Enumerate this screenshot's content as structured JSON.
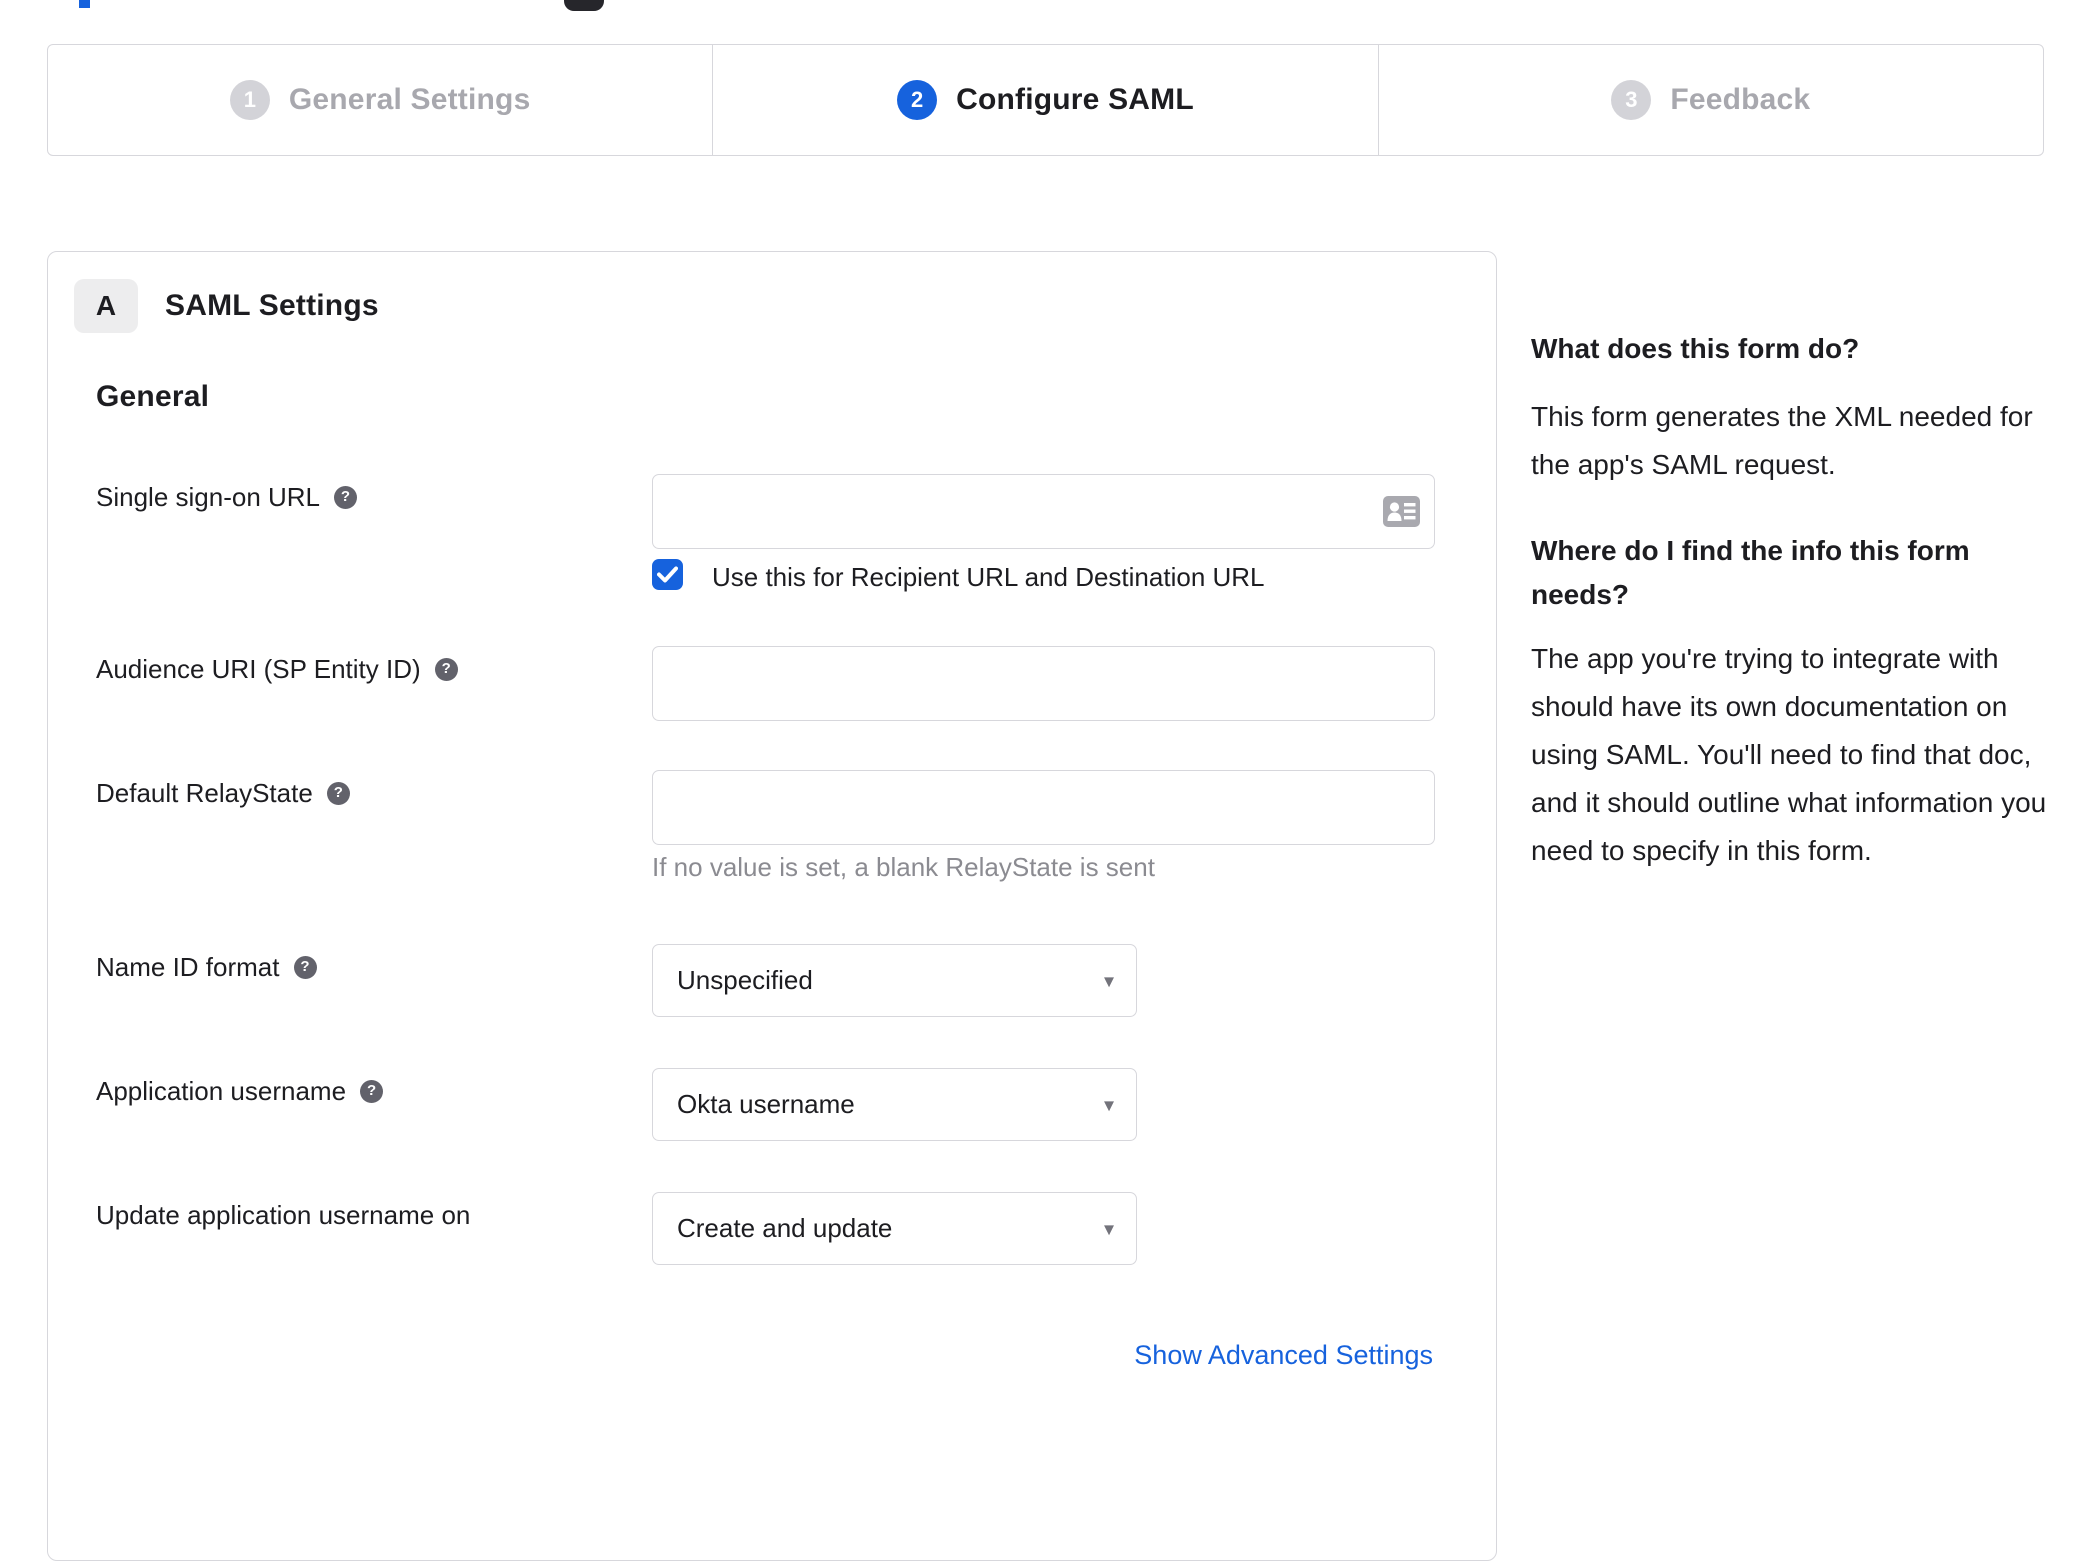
{
  "stepper": {
    "steps": [
      {
        "number": "1",
        "label": "General Settings",
        "state": "inactive"
      },
      {
        "number": "2",
        "label": "Configure SAML",
        "state": "active"
      },
      {
        "number": "3",
        "label": "Feedback",
        "state": "inactive"
      }
    ]
  },
  "panel": {
    "badge": "A",
    "title": "SAML Settings",
    "section": "General",
    "fields": {
      "sso": {
        "label": "Single sign-on URL",
        "value": "",
        "checkbox_label": "Use this for Recipient URL and Destination URL",
        "checked": true
      },
      "audience": {
        "label": "Audience URI (SP Entity ID)",
        "value": ""
      },
      "relay": {
        "label": "Default RelayState",
        "value": "",
        "hint": "If no value is set, a blank RelayState is sent"
      },
      "nameid": {
        "label": "Name ID format",
        "value": "Unspecified"
      },
      "appuser": {
        "label": "Application username",
        "value": "Okta username"
      },
      "updateuser": {
        "label": "Update application username on",
        "value": "Create and update"
      }
    },
    "advanced_link": "Show Advanced Settings"
  },
  "sidebar": {
    "q1": "What does this form do?",
    "a1": "This form generates the XML needed for the app's SAML request.",
    "q2": "Where do I find the info this form needs?",
    "a2": "The app you're trying to integrate with should have its own documentation on using SAML. You'll need to find that doc, and it should outline what information you need to specify in this form."
  },
  "glyphs": {
    "help": "?",
    "caret": "▾"
  },
  "colors": {
    "accent_blue": "#1662dd",
    "border_gray": "#d7d7dc",
    "inactive_gray": "#a8a8ae",
    "text_dark": "#1d1d21",
    "hint_gray": "#8b8b91"
  }
}
